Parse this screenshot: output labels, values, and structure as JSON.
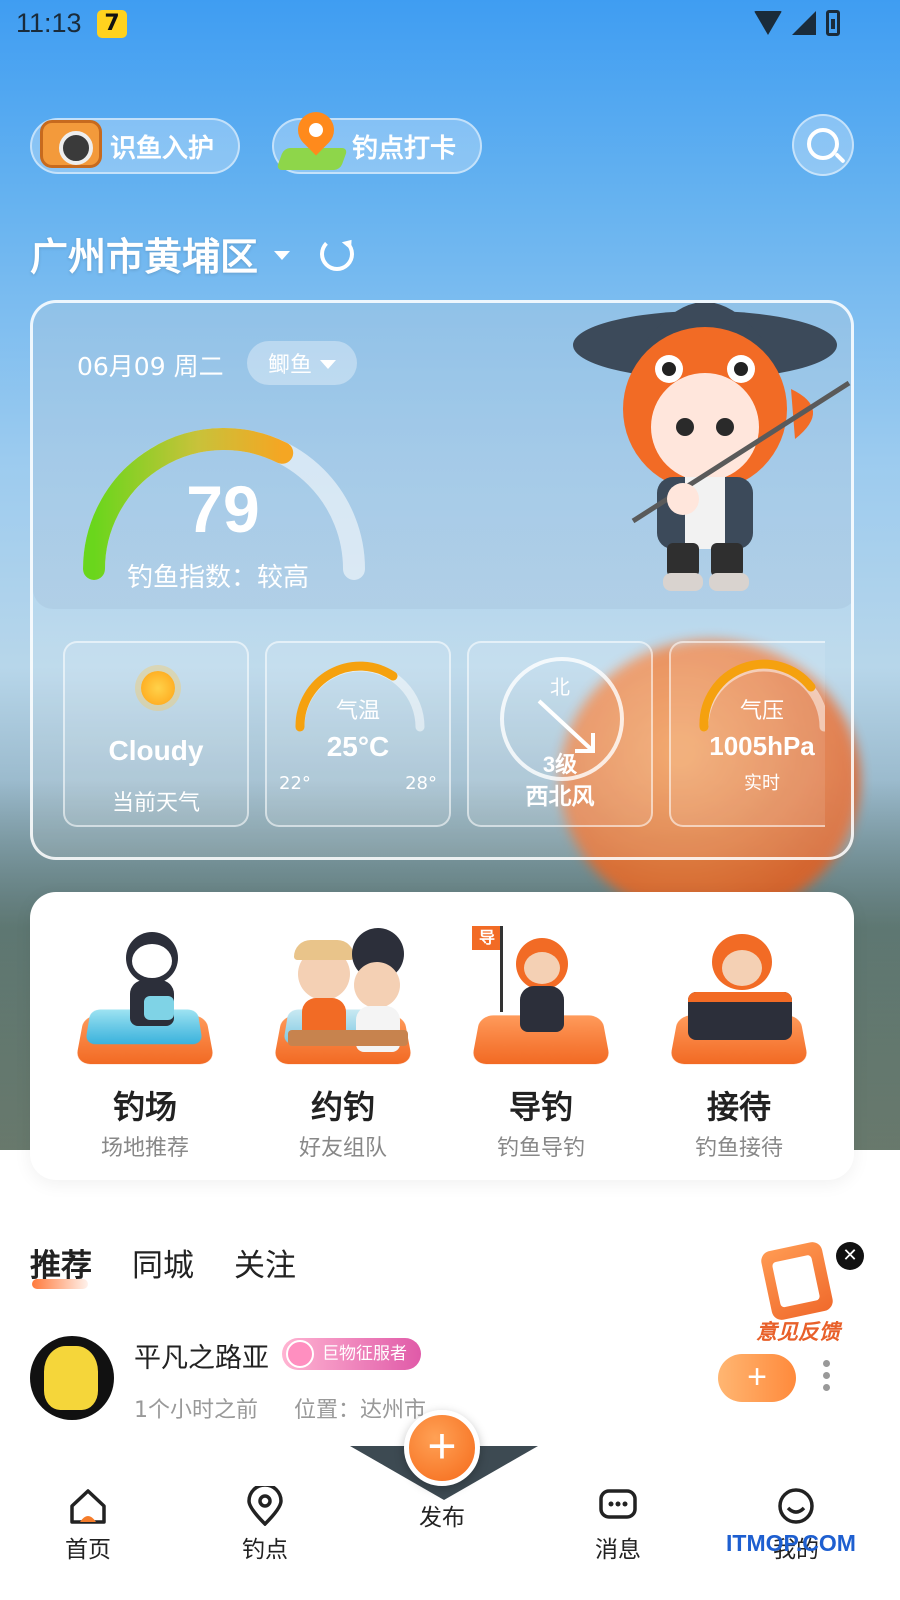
{
  "status_bar": {
    "time": "11:13",
    "app_badge": "7"
  },
  "top_actions": {
    "identify_fish": "识鱼入护",
    "spot_checkin": "钓点打卡"
  },
  "location": {
    "city": "广州市黄埔区"
  },
  "weather_card": {
    "date": "06月09 周二",
    "fish_type": "鲫鱼",
    "fishing_index": {
      "value": "79",
      "label": "钓鱼指数：较高",
      "level": 0.79
    },
    "tiles": {
      "weather": {
        "value": "Cloudy",
        "label": "当前天气"
      },
      "temperature": {
        "title": "气温",
        "value": "25°C",
        "min": "22°",
        "max": "28°"
      },
      "wind": {
        "compass": "北",
        "level": "3级",
        "direction": "西北风"
      },
      "pressure": {
        "title": "气压",
        "value": "1005hPa",
        "label": "实时"
      }
    }
  },
  "features": [
    {
      "title": "钓场",
      "subtitle": "场地推荐"
    },
    {
      "title": "约钓",
      "subtitle": "好友组队"
    },
    {
      "title": "导钓",
      "subtitle": "钓鱼导钓"
    },
    {
      "title": "接待",
      "subtitle": "钓鱼接待"
    }
  ],
  "guide_flag": "导",
  "feed_tabs": [
    "推荐",
    "同城",
    "关注"
  ],
  "feedback": {
    "label": "意见反馈",
    "close": "✕"
  },
  "post": {
    "username": "平凡之路亚",
    "badge": "巨物征服者",
    "time_ago": "1个小时之前",
    "location": "位置：达州市",
    "follow": "+"
  },
  "bottom_nav": {
    "home": "首页",
    "spots": "钓点",
    "publish": "发布",
    "publish_icon": "+",
    "messages": "消息",
    "profile": "我的"
  },
  "watermark": "ITMOP.COM",
  "colors": {
    "accent": "#f57c2a",
    "gauge_start": "#6ad61c",
    "gauge_end": "#f5a623"
  }
}
